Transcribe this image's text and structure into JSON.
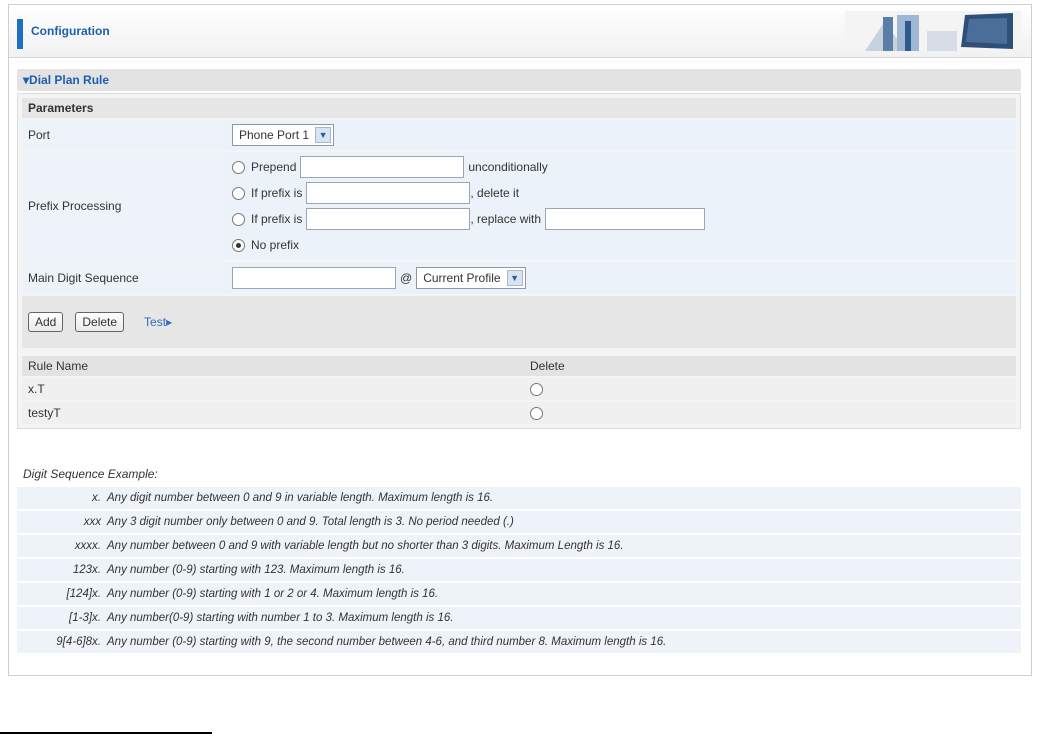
{
  "header": {
    "title": "Configuration"
  },
  "section": {
    "title": "▾Dial Plan Rule",
    "params_title": "Parameters"
  },
  "form": {
    "port_label": "Port",
    "port_value": "Phone Port 1",
    "prefix_label": "Prefix Processing",
    "prepend_label": "Prepend",
    "prepend_suffix": "unconditionally",
    "prefix_delete_label": "If prefix is",
    "delete_suffix": ", delete it",
    "prefix_replace_label": "If prefix is",
    "replace_with": ", replace with",
    "no_prefix_label": "No prefix",
    "main_digit_label": "Main Digit Sequence",
    "at_sign": "@",
    "profile_value": "Current Profile"
  },
  "buttons": {
    "add": "Add",
    "delete": "Delete",
    "test": "Test"
  },
  "rules": {
    "headers": [
      "Rule Name",
      "Delete"
    ],
    "rows": [
      {
        "name": "x.T"
      },
      {
        "name": "testyT"
      }
    ]
  },
  "examples": {
    "title": "Digit Sequence Example:",
    "items": [
      {
        "key": "x.",
        "desc": "Any digit number between 0 and 9 in variable length. Maximum length is 16."
      },
      {
        "key": "xxx",
        "desc": "Any 3 digit number only between 0 and 9. Total length is 3. No period needed (.)"
      },
      {
        "key": "xxxx.",
        "desc": "Any number between 0 and 9 with variable length but no shorter than 3 digits. Maximum Length is 16."
      },
      {
        "key": "123x.",
        "desc": "Any number (0-9) starting with 123. Maximum length is 16."
      },
      {
        "key": "[124]x.",
        "desc": "Any number (0-9) starting with 1 or 2 or 4. Maximum length is 16."
      },
      {
        "key": "[1-3]x.",
        "desc": "Any number(0-9) starting with number 1 to 3. Maximum length is 16."
      },
      {
        "key": "9[4-6]8x.",
        "desc": "Any number (0-9) starting with 9, the second number between 4-6, and third number 8. Maximum length is 16."
      }
    ]
  },
  "colors": {
    "accent": "#1d6fc1",
    "title": "#1d5fae",
    "link": "#2f6ec0"
  },
  "icons": {
    "logo": "office-banner-icon",
    "dropdown": "chevron-down-icon"
  }
}
